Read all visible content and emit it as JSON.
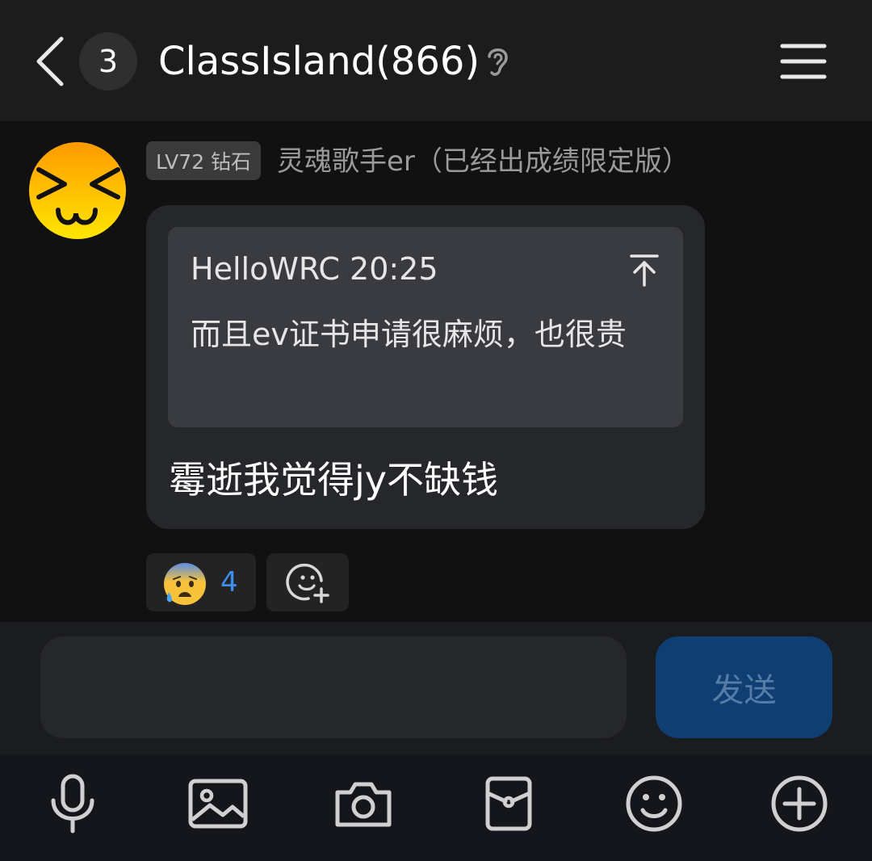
{
  "header": {
    "unread_count": "3",
    "title": "ClassIsland(866)",
    "icons": {
      "back": "chevron-left-icon",
      "listen": "ear-icon",
      "menu": "hamburger-menu-icon"
    }
  },
  "message": {
    "sender": {
      "level_badge": "LV72 钻石",
      "name": "灵魂歌手er（已经出成绩限定版）",
      "avatar": "squint-face-avatar"
    },
    "quote": {
      "meta": "HelloWRC 20:25",
      "text": "而且ev证书申请很麻烦，也很贵",
      "jump_icon": "arrow-up-to-line-icon"
    },
    "text": "霉逝我觉得jy不缺钱"
  },
  "reactions": [
    {
      "emoji": "anxious-face-with-sweat",
      "count": "4"
    }
  ],
  "composer": {
    "input_value": "",
    "send_label": "发送"
  },
  "toolbar": {
    "items": [
      "microphone-icon",
      "image-icon",
      "camera-icon",
      "red-packet-icon",
      "emoji-icon",
      "plus-icon"
    ]
  },
  "colors": {
    "background": "#111111",
    "header": "#1c1c1c",
    "bubble": "#26272b",
    "quote": "#3a3b40",
    "send_button": "#0f3e72",
    "reaction_count": "#3d8ef0"
  }
}
